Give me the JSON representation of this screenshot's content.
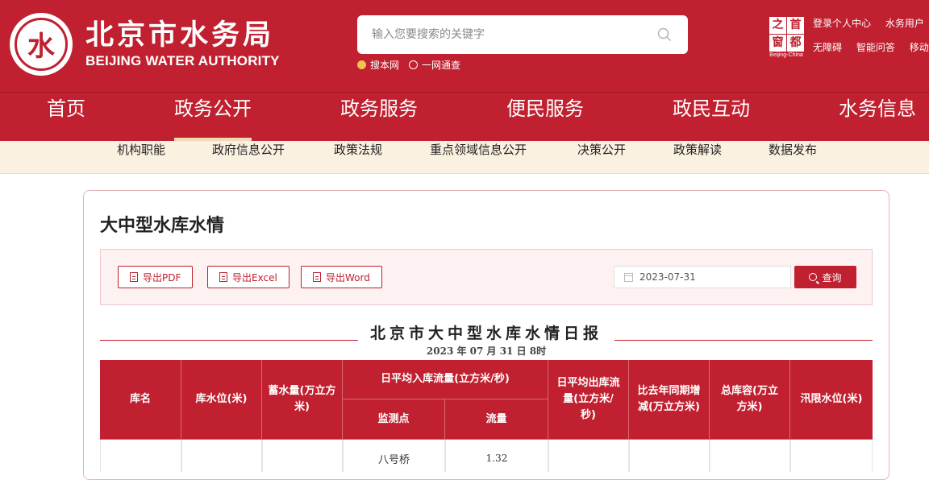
{
  "header": {
    "logo_emblem_char": "水",
    "title": "北京市水务局",
    "subtitle": "BEIJING WATER AUTHORITY",
    "search_placeholder": "输入您要搜索的关键字",
    "radio_this_site": "搜本网",
    "radio_all_site": "一网通查",
    "badge_chars": [
      "之",
      "首",
      "窗",
      "都"
    ],
    "badge_caption": "Beijing-China",
    "top_links_row1": [
      "登录个人中心",
      "水务用户"
    ],
    "top_links_row2": [
      "无障碍",
      "智能问答",
      "移动版"
    ]
  },
  "mainnav": {
    "items": [
      "首页",
      "政务公开",
      "政务服务",
      "便民服务",
      "政民互动",
      "水务信息"
    ],
    "active": "政务公开"
  },
  "subnav": {
    "items": [
      "机构职能",
      "政府信息公开",
      "政策法规",
      "重点领域信息公开",
      "决策公开",
      "政策解读",
      "数据发布"
    ]
  },
  "page": {
    "title": "大中型水库水情",
    "export_buttons": [
      "导出PDF",
      "导出Excel",
      "导出Word"
    ],
    "date_value": "2023-07-31",
    "query_label": "查询",
    "report_title": "北京市大中型水库水情日报",
    "report_date": "2023 年 07 月 31 日 8时"
  },
  "table": {
    "headers": {
      "name": "库名",
      "level": "库水位(米)",
      "storage": "蓄水量(万立方米)",
      "inflow_group": "日平均入库流量(立方米/秒)",
      "station": "监测点",
      "flow": "流量",
      "outflow": "日平均出库流量(立方米/秒)",
      "yoy": "比去年同期增减(万立方米)",
      "capacity": "总库容(万立方米)",
      "flood_level": "汛限水位(米)"
    },
    "rows": [
      {
        "station": "八号桥",
        "flow": "1.32"
      }
    ]
  },
  "colors": {
    "brand_red": "#c0202f",
    "subnav_bg": "#fbf1e1",
    "accent_gold": "#f3c24d"
  }
}
